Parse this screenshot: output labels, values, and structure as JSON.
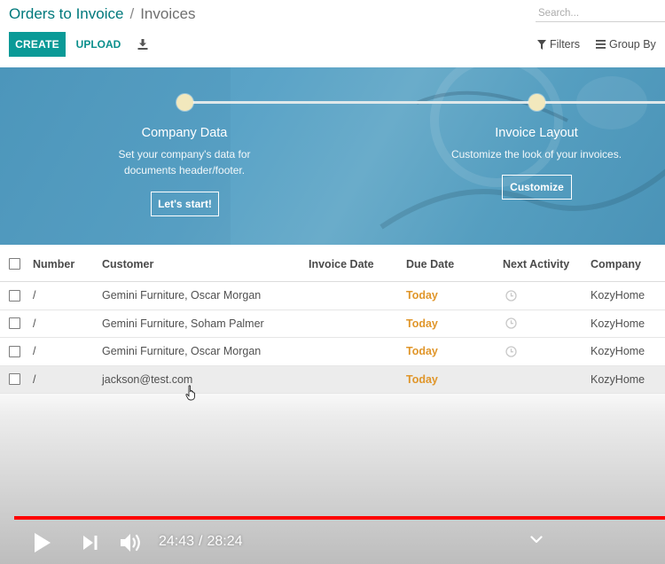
{
  "breadcrumb": {
    "parent": "Orders to Invoice",
    "separator": "/",
    "current": "Invoices"
  },
  "search": {
    "placeholder": "Search..."
  },
  "toolbar": {
    "create_label": "CREATE",
    "upload_label": "UPLOAD",
    "download_icon": "download-icon"
  },
  "filters": {
    "filters_label": "Filters",
    "groupby_label": "Group By"
  },
  "banner": {
    "steps": [
      {
        "title": "Company Data",
        "desc_line1": "Set your company's data for",
        "desc_line2": "documents header/footer.",
        "button": "Let's start!"
      },
      {
        "title": "Invoice Layout",
        "desc_line1": "Customize the look of your invoices.",
        "button": "Customize"
      }
    ],
    "dot_color": "#f2e8bd"
  },
  "table": {
    "columns": [
      "Number",
      "Customer",
      "Invoice Date",
      "Due Date",
      "Next Activity",
      "Company"
    ],
    "rows": [
      {
        "number": "/",
        "customer": "Gemini Furniture, Oscar Morgan",
        "invoice_date": "",
        "due_date": "Today",
        "company": "KozyHome"
      },
      {
        "number": "/",
        "customer": "Gemini Furniture, Soham Palmer",
        "invoice_date": "",
        "due_date": "Today",
        "company": "KozyHome"
      },
      {
        "number": "/",
        "customer": "Gemini Furniture, Oscar Morgan",
        "invoice_date": "",
        "due_date": "Today",
        "company": "KozyHome"
      },
      {
        "number": "/",
        "customer": "jackson@test.com",
        "invoice_date": "",
        "due_date": "Today",
        "company": "KozyHome"
      }
    ]
  },
  "player": {
    "current_time": "24:43",
    "separator": "/",
    "duration": "28:24",
    "progress_fraction": 0.87,
    "progress_color": "#ff0000"
  },
  "colors": {
    "brand": "#0a9a97",
    "due_today": "#e0962a"
  }
}
